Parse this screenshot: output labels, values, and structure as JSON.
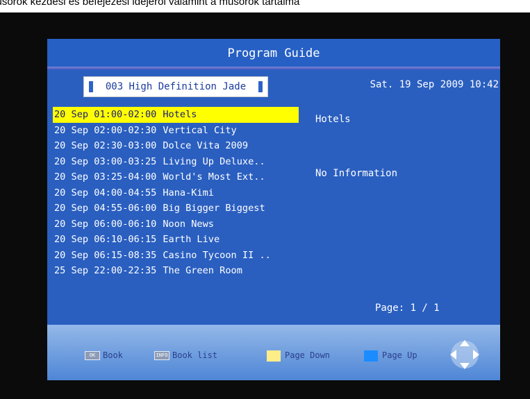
{
  "overlay_caption": "műsorok kezdési és befejezési idejéről valamint a műsorok tartalmá",
  "guide": {
    "title": "Program Guide",
    "channel": "003 High Definition Jade",
    "datetime": "Sat.  19 Sep 2009 10:42",
    "programs": [
      {
        "time": "20 Sep 01:00-02:00",
        "name": "Hotels",
        "selected": true
      },
      {
        "time": "20 Sep 02:00-02:30",
        "name": "Vertical City"
      },
      {
        "time": "20 Sep 02:30-03:00",
        "name": "Dolce Vita 2009"
      },
      {
        "time": "20 Sep 03:00-03:25",
        "name": "Living Up Deluxe.."
      },
      {
        "time": "20 Sep 03:25-04:00",
        "name": "World's Most Ext.."
      },
      {
        "time": "20 Sep 04:00-04:55",
        "name": "Hana-Kimi"
      },
      {
        "time": "20 Sep 04:55-06:00",
        "name": "Big Bigger Biggest"
      },
      {
        "time": "20 Sep 06:00-06:10",
        "name": "Noon News"
      },
      {
        "time": "20 Sep 06:10-06:15",
        "name": "Earth Live"
      },
      {
        "time": "20 Sep 06:15-08:35",
        "name": "Casino Tycoon II .."
      },
      {
        "time": "25 Sep 22:00-22:35",
        "name": "The Green Room"
      }
    ],
    "detail_title": "Hotels",
    "detail_info": "No Information",
    "page": "Page: 1 / 1"
  },
  "footer": {
    "ok_key": "OK",
    "book_label": "Book",
    "info_key": "INFO",
    "book_list_label": "Book list",
    "page_down_label": "Page Down",
    "page_up_label": "Page Up",
    "page_down_color": "#ffee88",
    "page_up_color": "#1a8cff",
    "nav_icon": "dpad-arrows-icon"
  }
}
